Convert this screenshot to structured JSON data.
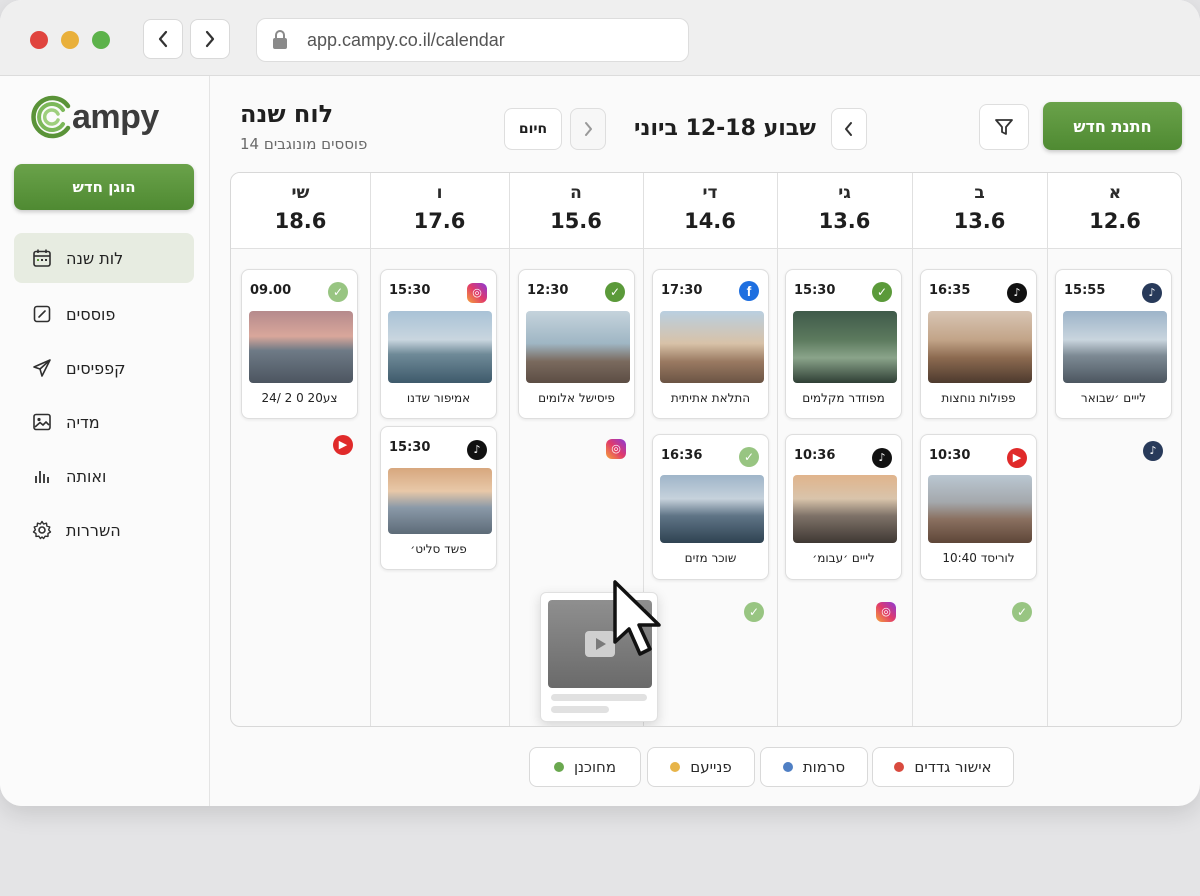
{
  "browser": {
    "url": "app.campy.co.il/calendar"
  },
  "brand": {
    "logo_text": "ampy",
    "logo_letter": "C"
  },
  "sidebar": {
    "new_button": "הוגן חדש",
    "items": [
      {
        "label": "לות שנה",
        "icon": "calendar-icon",
        "active": true
      },
      {
        "label": "פוססים",
        "icon": "edit-icon",
        "active": false
      },
      {
        "label": "קפפיסים",
        "icon": "send-icon",
        "active": false
      },
      {
        "label": "מדיה",
        "icon": "image-icon",
        "active": false
      },
      {
        "label": "ואותה",
        "icon": "bar-chart-icon",
        "active": false
      },
      {
        "label": "השררות",
        "icon": "gear-icon",
        "active": false
      }
    ]
  },
  "header": {
    "title": "לוח שנה",
    "subtitle": "14 פוססים מונוגבים",
    "today_button": "חיום",
    "week_label": "שבוע 12-18 ביוני",
    "create_button": "חתנת חדש"
  },
  "days": [
    {
      "name": "שי",
      "date": "18.6"
    },
    {
      "name": "ו",
      "date": "17.6"
    },
    {
      "name": "ה",
      "date": "15.6"
    },
    {
      "name": "די",
      "date": "14.6"
    },
    {
      "name": "גי",
      "date": "13.6"
    },
    {
      "name": "ב",
      "date": "13.6"
    },
    {
      "name": "א",
      "date": "12.6"
    }
  ],
  "posts": [
    {
      "time": "09.00",
      "caption": "24/ 2 0 20צע",
      "status": "check-light"
    },
    {
      "time": "15:30",
      "caption": "אמיפור שדנו",
      "status": "instagram"
    },
    {
      "time": "15:30",
      "caption": "פשד סליט׳",
      "status": "tiktok"
    },
    {
      "time": "12:30",
      "caption": "פיסישל אלומים",
      "status": "check"
    },
    {
      "time": "17:30",
      "caption": "התלאת אתיתית",
      "status": "facebook"
    },
    {
      "time": "16:36",
      "caption": "שוכר מזים",
      "status": "check-light"
    },
    {
      "time": "15:30",
      "caption": "מפוזדר מקלמים",
      "status": "check"
    },
    {
      "time": "10:36",
      "caption": "לייים ׳עבומ׳",
      "status": "tiktok"
    },
    {
      "time": "16:35",
      "caption": "פפולות נוחצות",
      "status": "tiktok"
    },
    {
      "time": "10:30",
      "caption": "10:40 לוריסד",
      "status": "youtube"
    },
    {
      "time": "15:55",
      "caption": "לייים ׳שבואר",
      "status": "tiktok-navy"
    }
  ],
  "legend": [
    {
      "label": "מחוכנן",
      "color": "#6aa84f"
    },
    {
      "label": "פנייעם",
      "color": "#e7b449"
    },
    {
      "label": "סרמות",
      "color": "#4f7fc4"
    },
    {
      "label": "אישור גדדים",
      "color": "#d94b3f"
    }
  ],
  "colors": {
    "accent": "#5a9338",
    "sidebar_active": "#e7ece1"
  }
}
